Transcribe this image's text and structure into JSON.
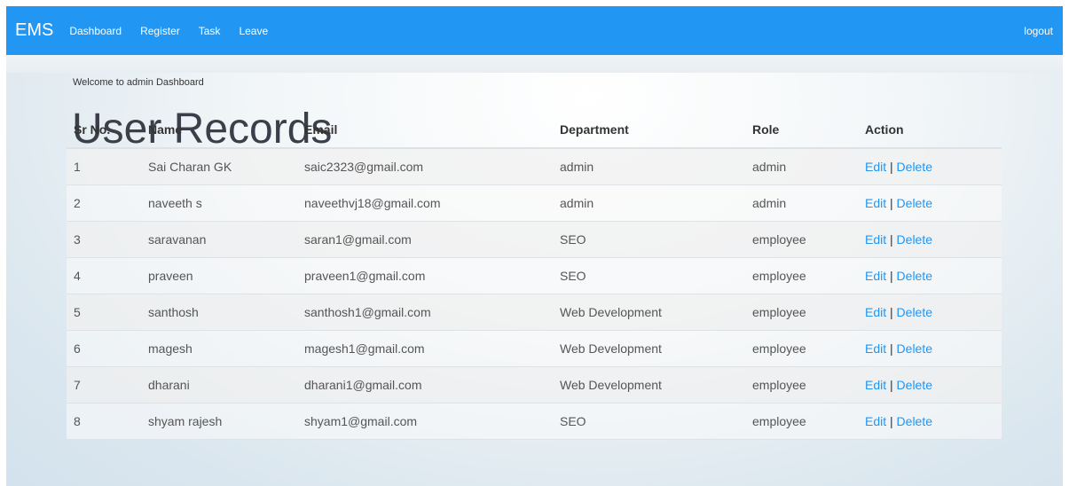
{
  "nav": {
    "brand": "EMS",
    "links": [
      "Dashboard",
      "Register",
      "Task",
      "Leave"
    ],
    "logout": "logout"
  },
  "page": {
    "welcome": "Welcome to admin Dashboard",
    "title": "User Records"
  },
  "table": {
    "headers": [
      "Sr No.",
      "Name",
      "Email",
      "Department",
      "Role",
      "Action"
    ],
    "rows": [
      {
        "sr": "1",
        "name": "Sai Charan GK",
        "email": "saic2323@gmail.com",
        "department": "admin",
        "role": "admin"
      },
      {
        "sr": "2",
        "name": "naveeth s",
        "email": "naveethvj18@gmail.com",
        "department": "admin",
        "role": "admin"
      },
      {
        "sr": "3",
        "name": "saravanan",
        "email": "saran1@gmail.com",
        "department": "SEO",
        "role": "employee"
      },
      {
        "sr": "4",
        "name": "praveen",
        "email": "praveen1@gmail.com",
        "department": "SEO",
        "role": "employee"
      },
      {
        "sr": "5",
        "name": "santhosh",
        "email": "santhosh1@gmail.com",
        "department": "Web Development",
        "role": "employee"
      },
      {
        "sr": "6",
        "name": "magesh",
        "email": "magesh1@gmail.com",
        "department": "Web Development",
        "role": "employee"
      },
      {
        "sr": "7",
        "name": "dharani",
        "email": "dharani1@gmail.com",
        "department": "Web Development",
        "role": "employee"
      },
      {
        "sr": "8",
        "name": "shyam rajesh",
        "email": "shyam1@gmail.com",
        "department": "SEO",
        "role": "employee"
      }
    ],
    "action": {
      "edit": "Edit",
      "separator": "|",
      "delete": "Delete"
    }
  },
  "colors": {
    "navbar": "#2196f3",
    "link": "#2196f3"
  }
}
